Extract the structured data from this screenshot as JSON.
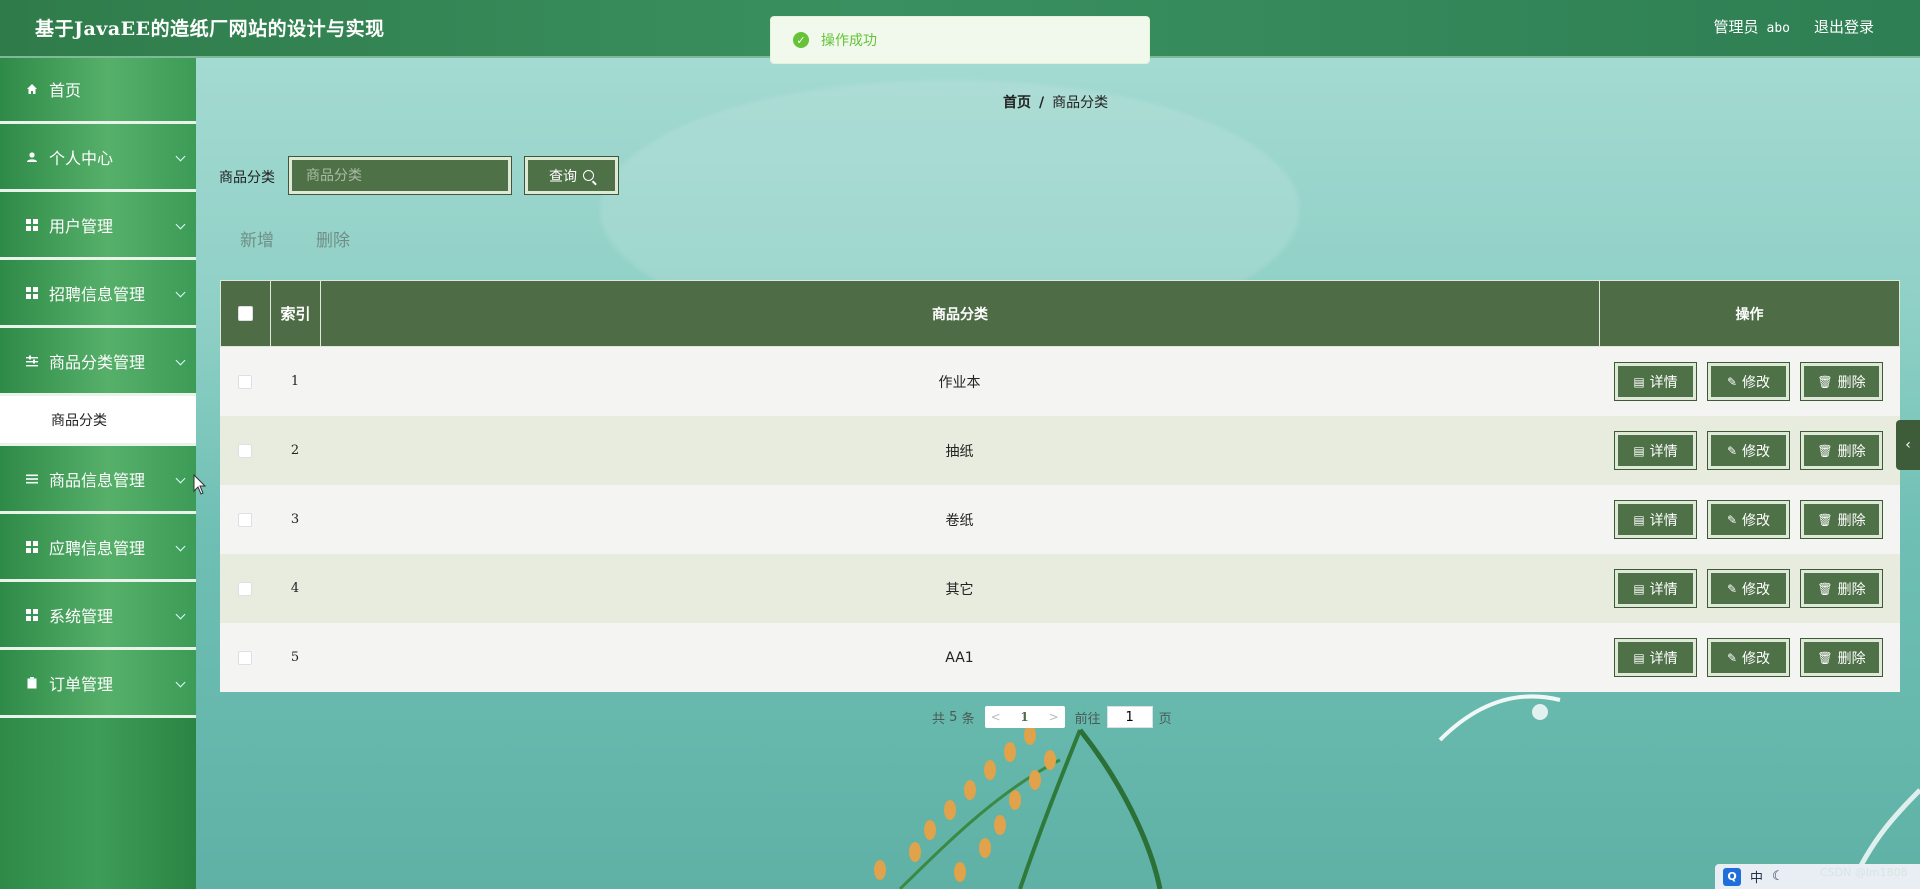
{
  "app": {
    "title": "基于JavaEE的造纸厂网站的设计与实现",
    "user_label": "管理员",
    "user_name": "abo",
    "logout_label": "退出登录"
  },
  "toast": {
    "message": "操作成功"
  },
  "sidebar": {
    "items": [
      {
        "label": "首页",
        "icon": "home-icon"
      },
      {
        "label": "个人中心",
        "icon": "user-icon"
      },
      {
        "label": "用户管理",
        "icon": "grid-icon"
      },
      {
        "label": "招聘信息管理",
        "icon": "grid-icon"
      },
      {
        "label": "商品分类管理",
        "icon": "sliders-icon"
      },
      {
        "label": "商品信息管理",
        "icon": "list-icon"
      },
      {
        "label": "应聘信息管理",
        "icon": "grid-icon"
      },
      {
        "label": "系统管理",
        "icon": "grid-icon"
      },
      {
        "label": "订单管理",
        "icon": "clipboard-icon"
      }
    ],
    "submenu_active": "商品分类"
  },
  "breadcrumb": {
    "home": "首页",
    "separator": "/",
    "current": "商品分类"
  },
  "search": {
    "label": "商品分类",
    "placeholder": "商品分类",
    "value": "",
    "button_label": "查询"
  },
  "actions": {
    "add_label": "新增",
    "delete_label": "删除"
  },
  "table": {
    "headers": {
      "index": "索引",
      "name": "商品分类",
      "ops": "操作"
    },
    "rows": [
      {
        "index": "1",
        "name": "作业本"
      },
      {
        "index": "2",
        "name": "抽纸"
      },
      {
        "index": "3",
        "name": "卷纸"
      },
      {
        "index": "4",
        "name": "其它"
      },
      {
        "index": "5",
        "name": "AA1"
      }
    ],
    "row_buttons": {
      "detail": "详情",
      "edit": "修改",
      "delete": "删除"
    }
  },
  "pagination": {
    "total_prefix": "共",
    "total": "5",
    "total_suffix": "条",
    "current_page": "1",
    "goto_prefix": "前往",
    "goto_value": "1",
    "goto_suffix": "页"
  },
  "tray": {
    "ime": "中",
    "watermark": "CSDN @lm1808"
  },
  "colors": {
    "header_green": "#3a9060",
    "sidebar_green": "#3d9d58",
    "table_header": "#4e6d47",
    "button_bg": "#4f7148",
    "toast_success": "#67c23a"
  }
}
